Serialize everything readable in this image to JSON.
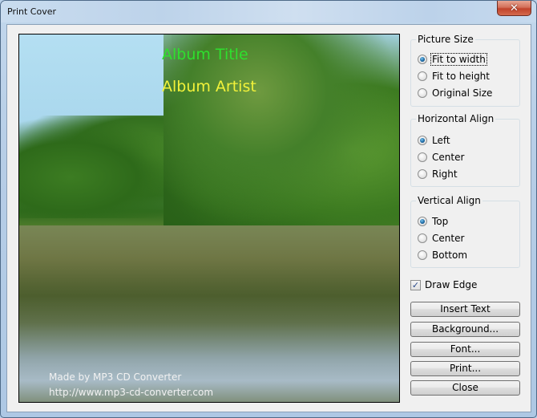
{
  "window": {
    "title": "Print Cover",
    "close_glyph": "✕"
  },
  "preview": {
    "album_title": "Album Title",
    "album_artist": "Album Artist",
    "credit_line_1": "Made by MP3 CD Converter",
    "credit_line_2": "http://www.mp3-cd-converter.com",
    "colors": {
      "album_title": "#2ee02e",
      "album_artist": "#f2f23a",
      "credit": "#f2f2f2"
    }
  },
  "picture_size": {
    "label": "Picture Size",
    "options": [
      {
        "label": "Fit to width",
        "checked": true
      },
      {
        "label": "Fit to height",
        "checked": false
      },
      {
        "label": "Original Size",
        "checked": false
      }
    ]
  },
  "horizontal_align": {
    "label": "Horizontal Align",
    "options": [
      {
        "label": "Left",
        "checked": true
      },
      {
        "label": "Center",
        "checked": false
      },
      {
        "label": "Right",
        "checked": false
      }
    ]
  },
  "vertical_align": {
    "label": "Vertical Align",
    "options": [
      {
        "label": "Top",
        "checked": true
      },
      {
        "label": "Center",
        "checked": false
      },
      {
        "label": "Bottom",
        "checked": false
      }
    ]
  },
  "draw_edge": {
    "label": "Draw Edge",
    "checked": true,
    "check_glyph": "✓"
  },
  "buttons": {
    "insert_text": "Insert Text",
    "background": "Background...",
    "font": "Font...",
    "print": "Print...",
    "close": "Close"
  }
}
